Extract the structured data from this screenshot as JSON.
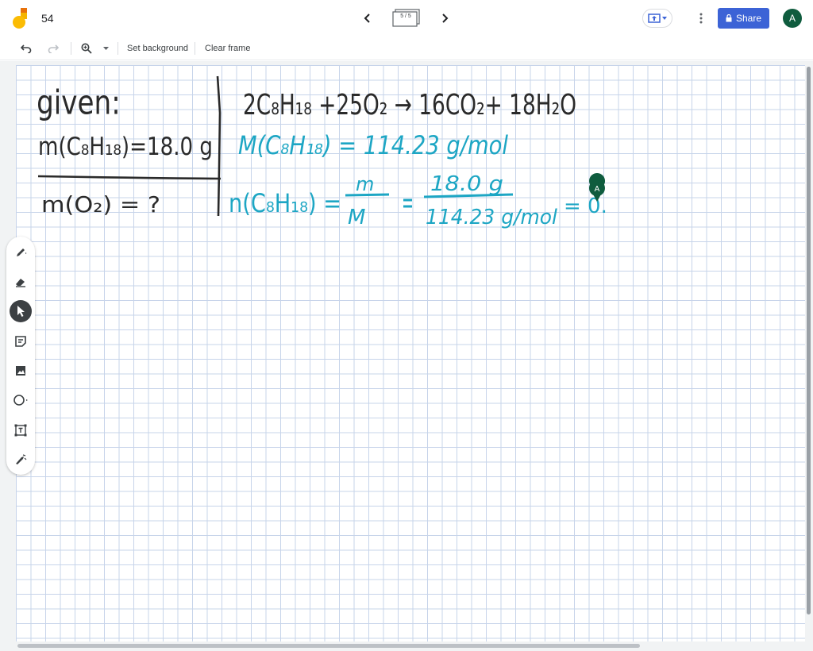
{
  "header": {
    "title": "54",
    "frame_counter": "5 / 5",
    "share_label": "Share",
    "avatar_initial": "A"
  },
  "toolbar": {
    "set_background": "Set background",
    "clear_frame": "Clear frame"
  },
  "board": {
    "given_label": "given:",
    "given_mass": "m(C₈H₁₈)=18.0 g",
    "unknown": "m(O₂) = ?",
    "equation": "2C₈H₁₈ +25O₂ → 16CO₂+ 18H₂O",
    "molar_mass": "M(C₈H₁₈) = 114.23 g/mol",
    "n_lhs": "n(C₈H₁₈) =",
    "frac1_num": "m",
    "frac1_den": "M",
    "frac2_num": "18.0 g",
    "frac2_den": "114.23 g/mol",
    "result_partial": "= 0.",
    "cursor_initial": "A"
  },
  "colors": {
    "ink_black": "#2a2a2a",
    "ink_teal": "#1da6c4",
    "share_blue": "#3c63d6",
    "avatar_green": "#0f5c3e",
    "grid": "#c7d4ea"
  },
  "icons": [
    "jamboard-logo-icon",
    "chevron-left-icon",
    "chevron-right-icon",
    "frames-icon",
    "present-icon",
    "more-vert-icon",
    "lock-icon",
    "undo-icon",
    "redo-icon",
    "zoom-icon",
    "pen-icon",
    "eraser-icon",
    "select-icon",
    "sticky-note-icon",
    "image-icon",
    "circle-icon",
    "text-box-icon",
    "laser-icon"
  ]
}
